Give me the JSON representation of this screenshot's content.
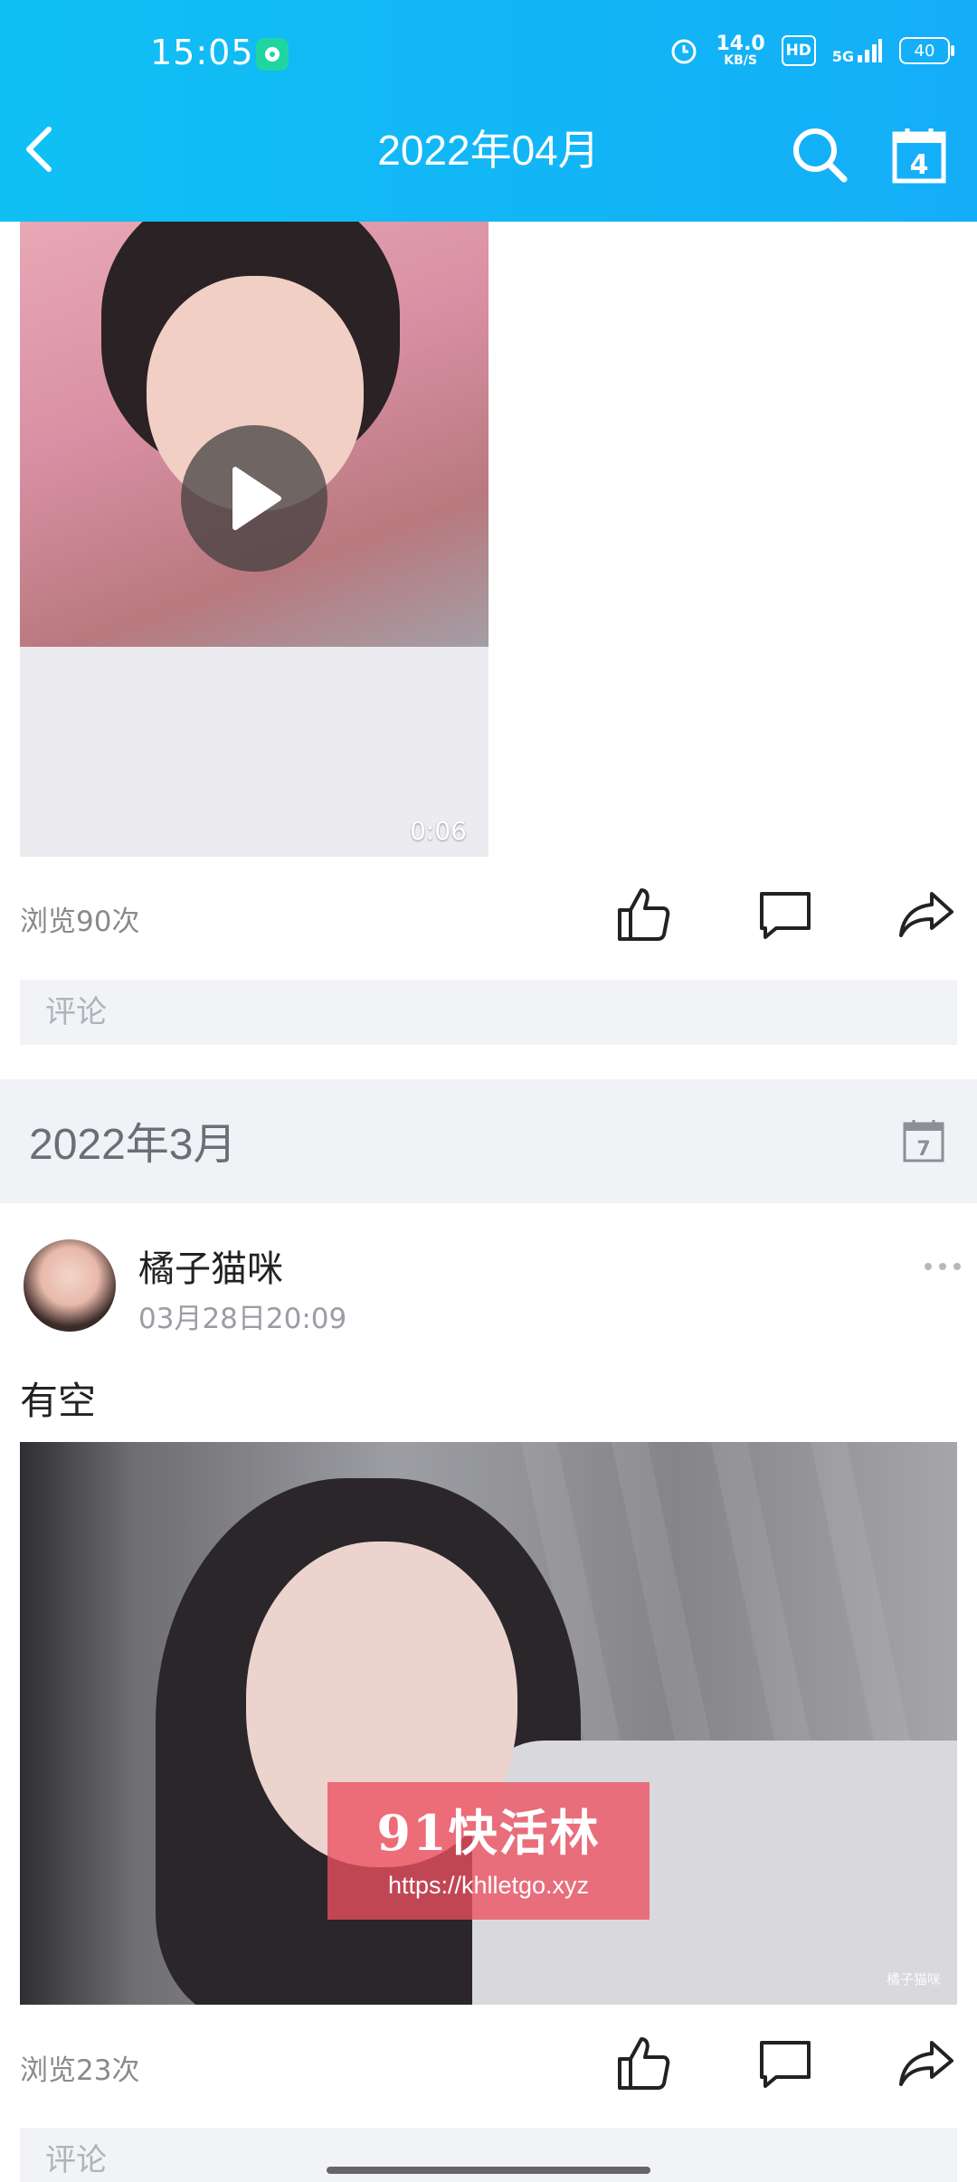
{
  "status_bar": {
    "time": "15:05",
    "speed_value": "14.0",
    "speed_unit": "KB/S",
    "hd": "HD",
    "network": "5G",
    "battery": "40"
  },
  "header": {
    "title": "2022年04月"
  },
  "post1": {
    "video_duration": "0:06",
    "views": "浏览90次",
    "comment_placeholder": "评论"
  },
  "section": {
    "title": "2022年3月",
    "calendar_day": "7"
  },
  "post2": {
    "author": "橘子猫咪",
    "time": "03月28日20:09",
    "caption": "有空",
    "watermark_brand": "91快活林",
    "watermark_url": "https://khlletgo.xyz",
    "watermark_small": "橘子猫咪",
    "views": "浏览23次",
    "comment_placeholder": "评论"
  },
  "icons": {
    "calendar_day_header": "4"
  },
  "colors": {
    "header_bg": "#12b6f6",
    "section_bg": "#f1f2f6",
    "comment_bg": "#f1f3f7",
    "watermark_bg": "#ec5060"
  }
}
